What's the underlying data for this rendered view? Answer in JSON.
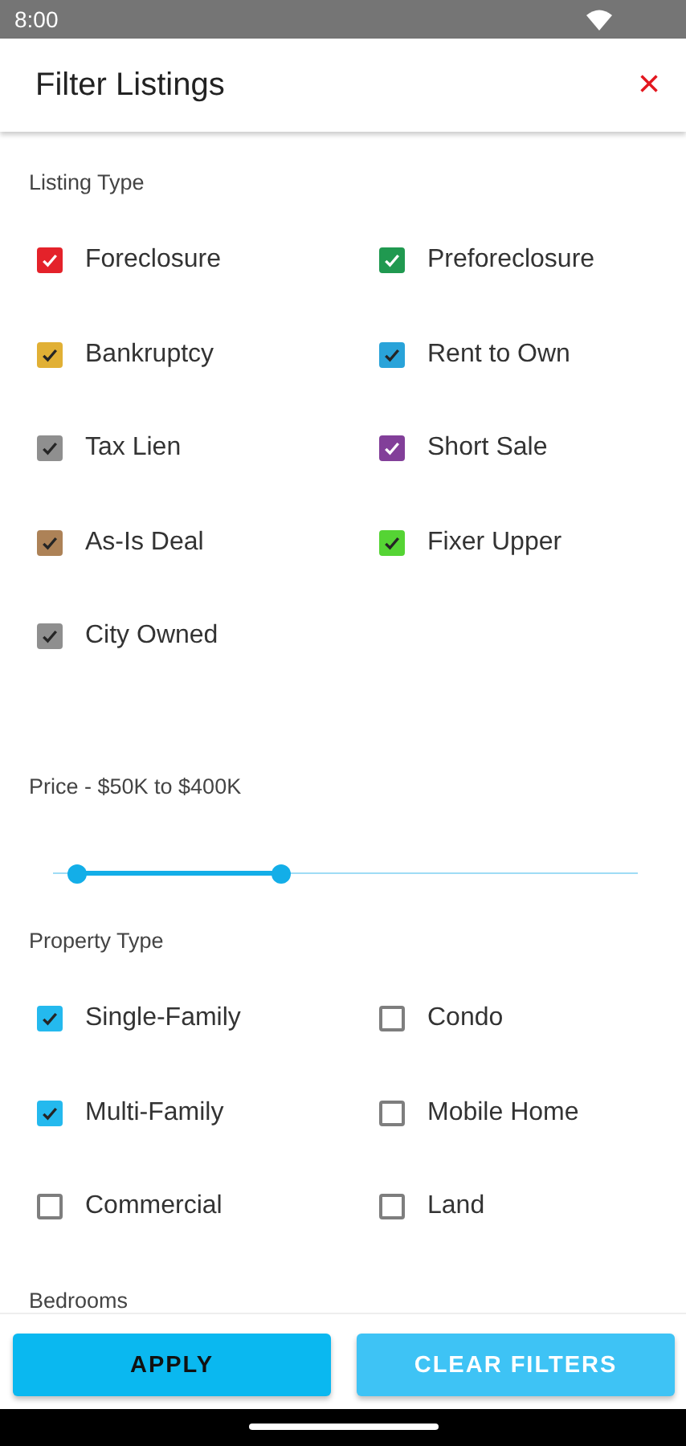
{
  "status_bar": {
    "time": "8:00"
  },
  "header": {
    "title": "Filter Listings",
    "close_icon": "×"
  },
  "listing_type": {
    "label": "Listing Type",
    "options": [
      {
        "label": "Foreclosure",
        "checked": true,
        "color": "#e3171f"
      },
      {
        "label": "Preforeclosure",
        "checked": true,
        "color": "#159447"
      },
      {
        "label": "Bankruptcy",
        "checked": true,
        "color": "#e0ac2b"
      },
      {
        "label": "Rent to Own",
        "checked": true,
        "color": "#1e9fd8"
      },
      {
        "label": "Tax Lien",
        "checked": true,
        "color": "#8a8a8a"
      },
      {
        "label": "Short Sale",
        "checked": true,
        "color": "#7c3594"
      },
      {
        "label": "As-Is Deal",
        "checked": true,
        "color": "#a97c4f"
      },
      {
        "label": "Fixer Upper",
        "checked": true,
        "color": "#4cd22a"
      },
      {
        "label": "City Owned",
        "checked": true,
        "color": "#8a8a8a"
      }
    ]
  },
  "price": {
    "label": "Price - $50K to $400K",
    "thumbs": [
      {
        "level": 0.04
      },
      {
        "level": 0.39
      }
    ]
  },
  "property_type": {
    "label": "Property Type",
    "options": [
      {
        "label": "Single-Family",
        "checked": true
      },
      {
        "label": "Condo",
        "checked": false
      },
      {
        "label": "Multi-Family",
        "checked": true
      },
      {
        "label": "Mobile Home",
        "checked": false
      },
      {
        "label": "Commercial",
        "checked": false
      },
      {
        "label": "Land",
        "checked": false
      }
    ]
  },
  "bedrooms": {
    "label": "Bedrooms"
  },
  "buttons": [
    {
      "label": "APPLY",
      "kind": "primary"
    },
    {
      "label": "CLEAR FILTERS",
      "kind": "secondary"
    }
  ]
}
